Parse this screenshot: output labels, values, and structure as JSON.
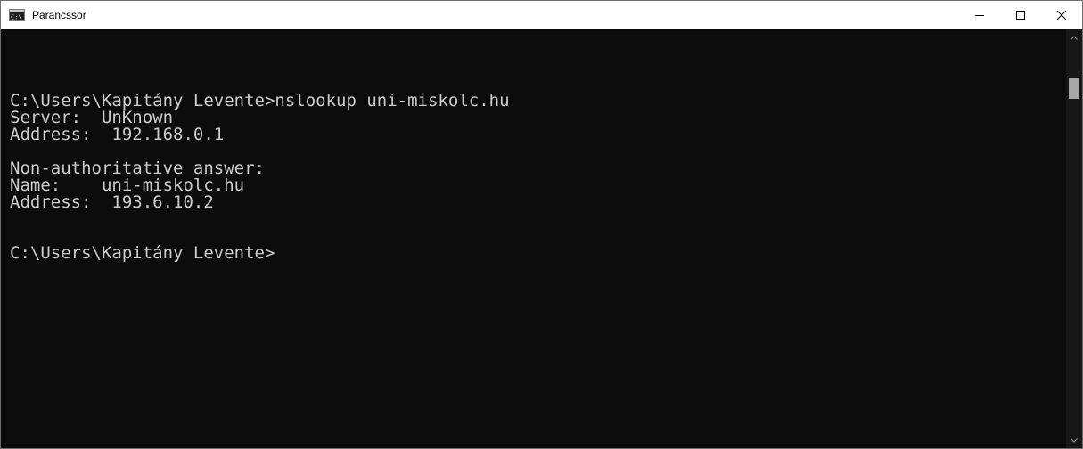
{
  "window": {
    "title": "Parancssor",
    "icon": "cmd-icon",
    "controls": {
      "minimize_icon": "minimize-icon",
      "maximize_icon": "maximize-icon",
      "close_icon": "close-icon"
    }
  },
  "console": {
    "lines": [
      "",
      "C:\\Users\\Kapitány Levente>nslookup uni-miskolc.hu",
      "Server:  UnKnown",
      "Address:  192.168.0.1",
      "",
      "Non-authoritative answer:",
      "Name:    uni-miskolc.hu",
      "Address:  193.6.10.2",
      "",
      "",
      "C:\\Users\\Kapitány Levente>"
    ]
  },
  "colors": {
    "console_background": "#0c0c0c",
    "console_text": "#cccccc",
    "titlebar_background": "#ffffff",
    "scrollbar_thumb": "#a6a6a6"
  }
}
